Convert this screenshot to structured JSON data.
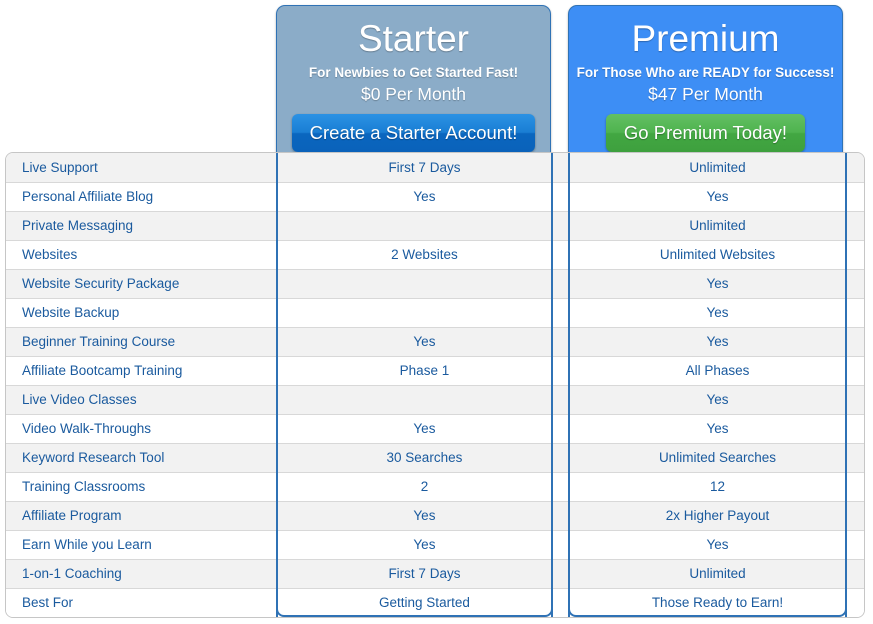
{
  "plans": [
    {
      "id": "starter",
      "name": "Starter",
      "tagline": "For Newbies to Get Started Fast!",
      "price": "$0 Per Month",
      "cta_label": "Create a Starter Account!",
      "panel_color": "#8bacc8",
      "cta_color": "#1a7ed4"
    },
    {
      "id": "premium",
      "name": "Premium",
      "tagline": "For Those Who are READY for Success!",
      "price": "$47 Per Month",
      "cta_label": "Go Premium Today!",
      "panel_color": "#3d8ef5",
      "cta_color": "#4fb34f"
    }
  ],
  "table": {
    "text_color": "#1a5a9e",
    "rows": [
      {
        "feature": "Live Support",
        "starter": "First 7 Days",
        "premium": "Unlimited"
      },
      {
        "feature": "Personal Affiliate Blog",
        "starter": "Yes",
        "premium": "Yes"
      },
      {
        "feature": "Private Messaging",
        "starter": "",
        "premium": "Unlimited"
      },
      {
        "feature": "Websites",
        "starter": "2 Websites",
        "premium": "Unlimited Websites"
      },
      {
        "feature": "Website Security Package",
        "starter": "",
        "premium": "Yes"
      },
      {
        "feature": "Website Backup",
        "starter": "",
        "premium": "Yes"
      },
      {
        "feature": "Beginner Training Course",
        "starter": "Yes",
        "premium": "Yes"
      },
      {
        "feature": "Affiliate Bootcamp Training",
        "starter": "Phase 1",
        "premium": "All Phases"
      },
      {
        "feature": "Live Video Classes",
        "starter": "",
        "premium": "Yes"
      },
      {
        "feature": "Video Walk-Throughs",
        "starter": "Yes",
        "premium": "Yes"
      },
      {
        "feature": "Keyword Research Tool",
        "starter": "30 Searches",
        "premium": "Unlimited Searches"
      },
      {
        "feature": "Training Classrooms",
        "starter": "2",
        "premium": "12"
      },
      {
        "feature": "Affiliate Program",
        "starter": "Yes",
        "premium": "2x Higher Payout"
      },
      {
        "feature": "Earn While you Learn",
        "starter": "Yes",
        "premium": "Yes"
      },
      {
        "feature": "1-on-1 Coaching",
        "starter": "First 7 Days",
        "premium": "Unlimited"
      },
      {
        "feature": "Best For",
        "starter": "Getting Started",
        "premium": "Those Ready to Earn!"
      }
    ]
  }
}
